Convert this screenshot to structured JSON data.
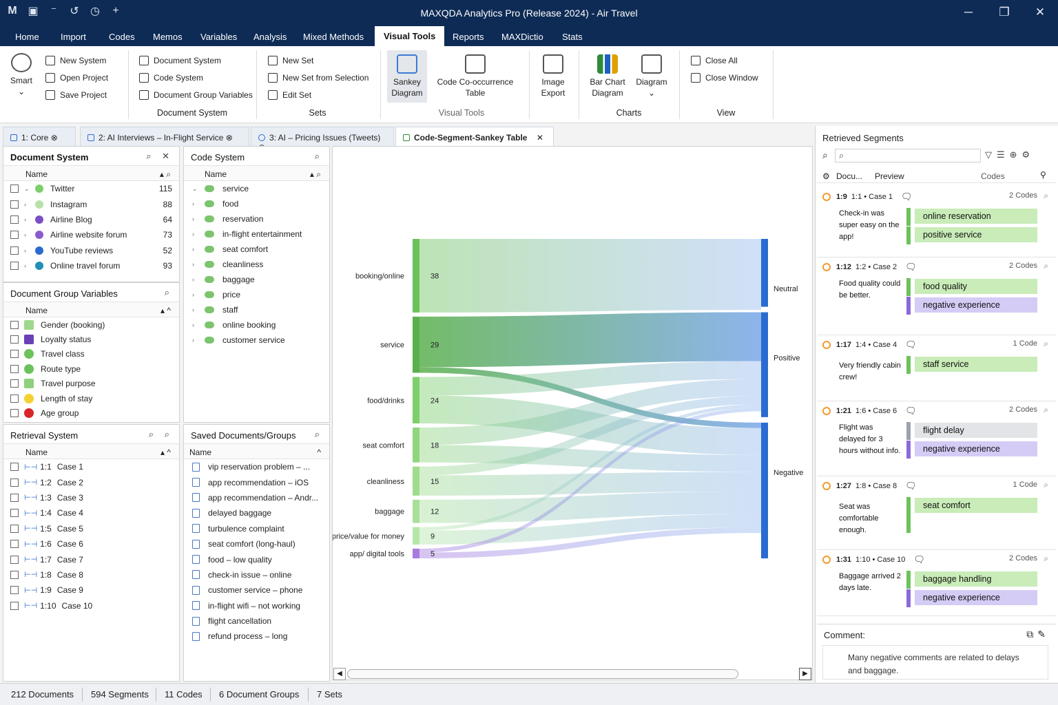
{
  "window": {
    "title": "MAXQDA Analytics Pro (Release 2024) - Air Travel",
    "logo": "M"
  },
  "menu": [
    "Home",
    "Import",
    "Codes",
    "Memos",
    "Variables",
    "Analysis",
    "Mixed Methods",
    "Visual Tools",
    "Reports",
    "MAXDictio",
    "Stats"
  ],
  "ribbon": {
    "smart": "Smart",
    "small_col1": [
      "New System",
      "Open Project",
      "Save Project"
    ],
    "small_col2": [
      "Document System",
      "Code System",
      "Document Group Variables"
    ],
    "group1": "Document System",
    "small_col3": [
      "New Set",
      "New Set from Selection",
      "Edit Set"
    ],
    "group2": "Sets",
    "sankey": "Sankey Diagram",
    "cooc": "Code Co-occurrence Table",
    "group3": "Visual Tools",
    "image_export": "Image Export",
    "barchart": "Bar Chart Diagram",
    "diagram": "Diagram",
    "group4": "Charts",
    "small_col4": [
      "Close All",
      "Close Window"
    ],
    "group5": "View"
  },
  "tabs": [
    {
      "label": "1: Core"
    },
    {
      "label": "2: AI Interviews – In-Flight Service"
    },
    {
      "label": "3: AI – Pricing Issues (Tweets)"
    },
    {
      "label": "Code-Segment-Sankey Table"
    }
  ],
  "document_system": {
    "title": "Document System",
    "col": "Name",
    "items": [
      {
        "label": "Twitter",
        "count": "115",
        "color": "#7ccf6a"
      },
      {
        "label": "Instagram",
        "count": "88",
        "color": "#b8e0a8"
      },
      {
        "label": "Airline Blog",
        "count": "64",
        "color": "#7b4fc4"
      },
      {
        "label": "Airline website forum",
        "count": "73",
        "color": "#8a5bd0"
      },
      {
        "label": "YouTube reviews",
        "count": "52",
        "color": "#2a6bd1"
      },
      {
        "label": "Online travel forum",
        "count": "93",
        "color": "#1f8fb5"
      }
    ]
  },
  "doc_group_vars": {
    "title": "Document Group Variables",
    "col": "Name",
    "items": [
      {
        "label": "Gender (booking)",
        "color": "#9ed88f"
      },
      {
        "label": "Loyalty status",
        "color": "#6b3fb8"
      },
      {
        "label": "Travel class",
        "color": "#6cc25a"
      },
      {
        "label": "Route type",
        "color": "#6cc25a"
      },
      {
        "label": "Travel purpose",
        "color": "#8fd07e"
      },
      {
        "label": "Length of stay",
        "color": "#f5d033"
      },
      {
        "label": "Age group",
        "color": "#d8262a"
      }
    ]
  },
  "retrieval_system": {
    "title": "Retrieval System",
    "col": "Name",
    "items": [
      {
        "id": "1:1",
        "label": "Case 1"
      },
      {
        "id": "1:2",
        "label": "Case 2"
      },
      {
        "id": "1:3",
        "label": "Case 3"
      },
      {
        "id": "1:4",
        "label": "Case 4"
      },
      {
        "id": "1:5",
        "label": "Case 5"
      },
      {
        "id": "1:6",
        "label": "Case 6"
      },
      {
        "id": "1:7",
        "label": "Case 7"
      },
      {
        "id": "1:8",
        "label": "Case 8"
      },
      {
        "id": "1:9",
        "label": "Case 9"
      },
      {
        "id": "1:10",
        "label": "Case 10"
      }
    ]
  },
  "code_system": {
    "title": "Code System",
    "col": "Name",
    "items": [
      "service",
      "food",
      "reservation",
      "in-flight entertainment",
      "seat comfort",
      "cleanliness",
      "baggage",
      "price",
      "staff",
      "online booking",
      "customer service"
    ]
  },
  "saved_docs": {
    "title": "Saved Documents/Groups",
    "col": "Name",
    "items": [
      "vip reservation problem – ...",
      "app recommendation – iOS",
      "app recommendation – Andr...",
      "delayed baggage",
      "turbulence complaint",
      "seat comfort (long-haul)",
      "food – low quality",
      "check-in issue – online",
      "customer service – phone",
      "in-flight wifi – not working",
      "flight cancellation",
      "refund process – long"
    ]
  },
  "chart_data": {
    "type": "sankey",
    "sources": [
      {
        "name": "booking/online",
        "value": 38,
        "color": "#6cc25a"
      },
      {
        "name": "service",
        "value": 29,
        "color": "#5bb04e"
      },
      {
        "name": "food/drinks",
        "value": 24,
        "color": "#7ccf6a"
      },
      {
        "name": "seat comfort",
        "value": 18,
        "color": "#8fd67e"
      },
      {
        "name": "cleanliness",
        "value": 15,
        "color": "#9fdc8e"
      },
      {
        "name": "baggage",
        "value": 12,
        "color": "#a8e09a"
      },
      {
        "name": "price/value for money",
        "value": 9,
        "color": "#b6e6aa"
      },
      {
        "name": "app/ digital tools",
        "value": 5,
        "color": "#a77be0"
      }
    ],
    "targets": [
      {
        "name": "Neutral",
        "color": "#2a6bd1"
      },
      {
        "name": "Positive",
        "color": "#2a6bd1"
      },
      {
        "name": "Negative",
        "color": "#2a6bd1"
      }
    ]
  },
  "retrieved": {
    "title": "Retrieved Segments",
    "col_doc": "Docu...",
    "col_preview": "Preview",
    "col_codes": "Codes",
    "segments": [
      {
        "id": "1:9",
        "case": "1:1 • Case 1",
        "codes": "2 Codes",
        "text": "Check-in was super easy on the app!",
        "chips": [
          {
            "label": "online reservation",
            "color": "#c9ecb8",
            "bar": "#6cc25a"
          },
          {
            "label": "positive service",
            "color": "#c9ecb8",
            "bar": "#6cc25a"
          }
        ]
      },
      {
        "id": "1:12",
        "case": "1:2 • Case 2",
        "codes": "2 Codes",
        "text": "Food quality could be better.",
        "chips": [
          {
            "label": "food quality",
            "color": "#c9ecb8",
            "bar": "#6cc25a"
          },
          {
            "label": "negative experience",
            "color": "#d4ccf5",
            "bar": "#8a6ad8"
          }
        ]
      },
      {
        "id": "1:17",
        "case": "1:4 • Case 4",
        "codes": "1 Code",
        "text": "Very friendly cabin crew!",
        "chips": [
          {
            "label": "staff service",
            "color": "#c9ecb8",
            "bar": "#6cc25a"
          }
        ]
      },
      {
        "id": "1:21",
        "case": "1:6 • Case 6",
        "codes": "2 Codes",
        "text": "Flight was delayed for 3 hours without info.",
        "chips": [
          {
            "label": "flight delay",
            "color": "#e2e4e8",
            "bar": "#9aa3ae"
          },
          {
            "label": "negative experience",
            "color": "#d4ccf5",
            "bar": "#8a6ad8"
          }
        ]
      },
      {
        "id": "1:27",
        "case": "1:8 • Case 8",
        "codes": "1 Code",
        "text": "Seat was comfortable enough.",
        "chips": [
          {
            "label": "seat comfort",
            "color": "#c9ecb8",
            "bar": "#6cc25a"
          }
        ]
      },
      {
        "id": "1:31",
        "case": "1:10 • Case 10",
        "codes": "2 Codes",
        "text": "Baggage arrived 2 days late.",
        "chips": [
          {
            "label": "baggage handling",
            "color": "#c9ecb8",
            "bar": "#6cc25a"
          },
          {
            "label": "negative experience",
            "color": "#d4ccf5",
            "bar": "#8a6ad8"
          }
        ]
      }
    ]
  },
  "comment": {
    "label": "Comment:",
    "text": "Many negative comments are related to delays and baggage."
  },
  "status": [
    "212 Documents",
    "594 Segments",
    "11 Codes",
    "6 Document Groups",
    "7 Sets"
  ]
}
